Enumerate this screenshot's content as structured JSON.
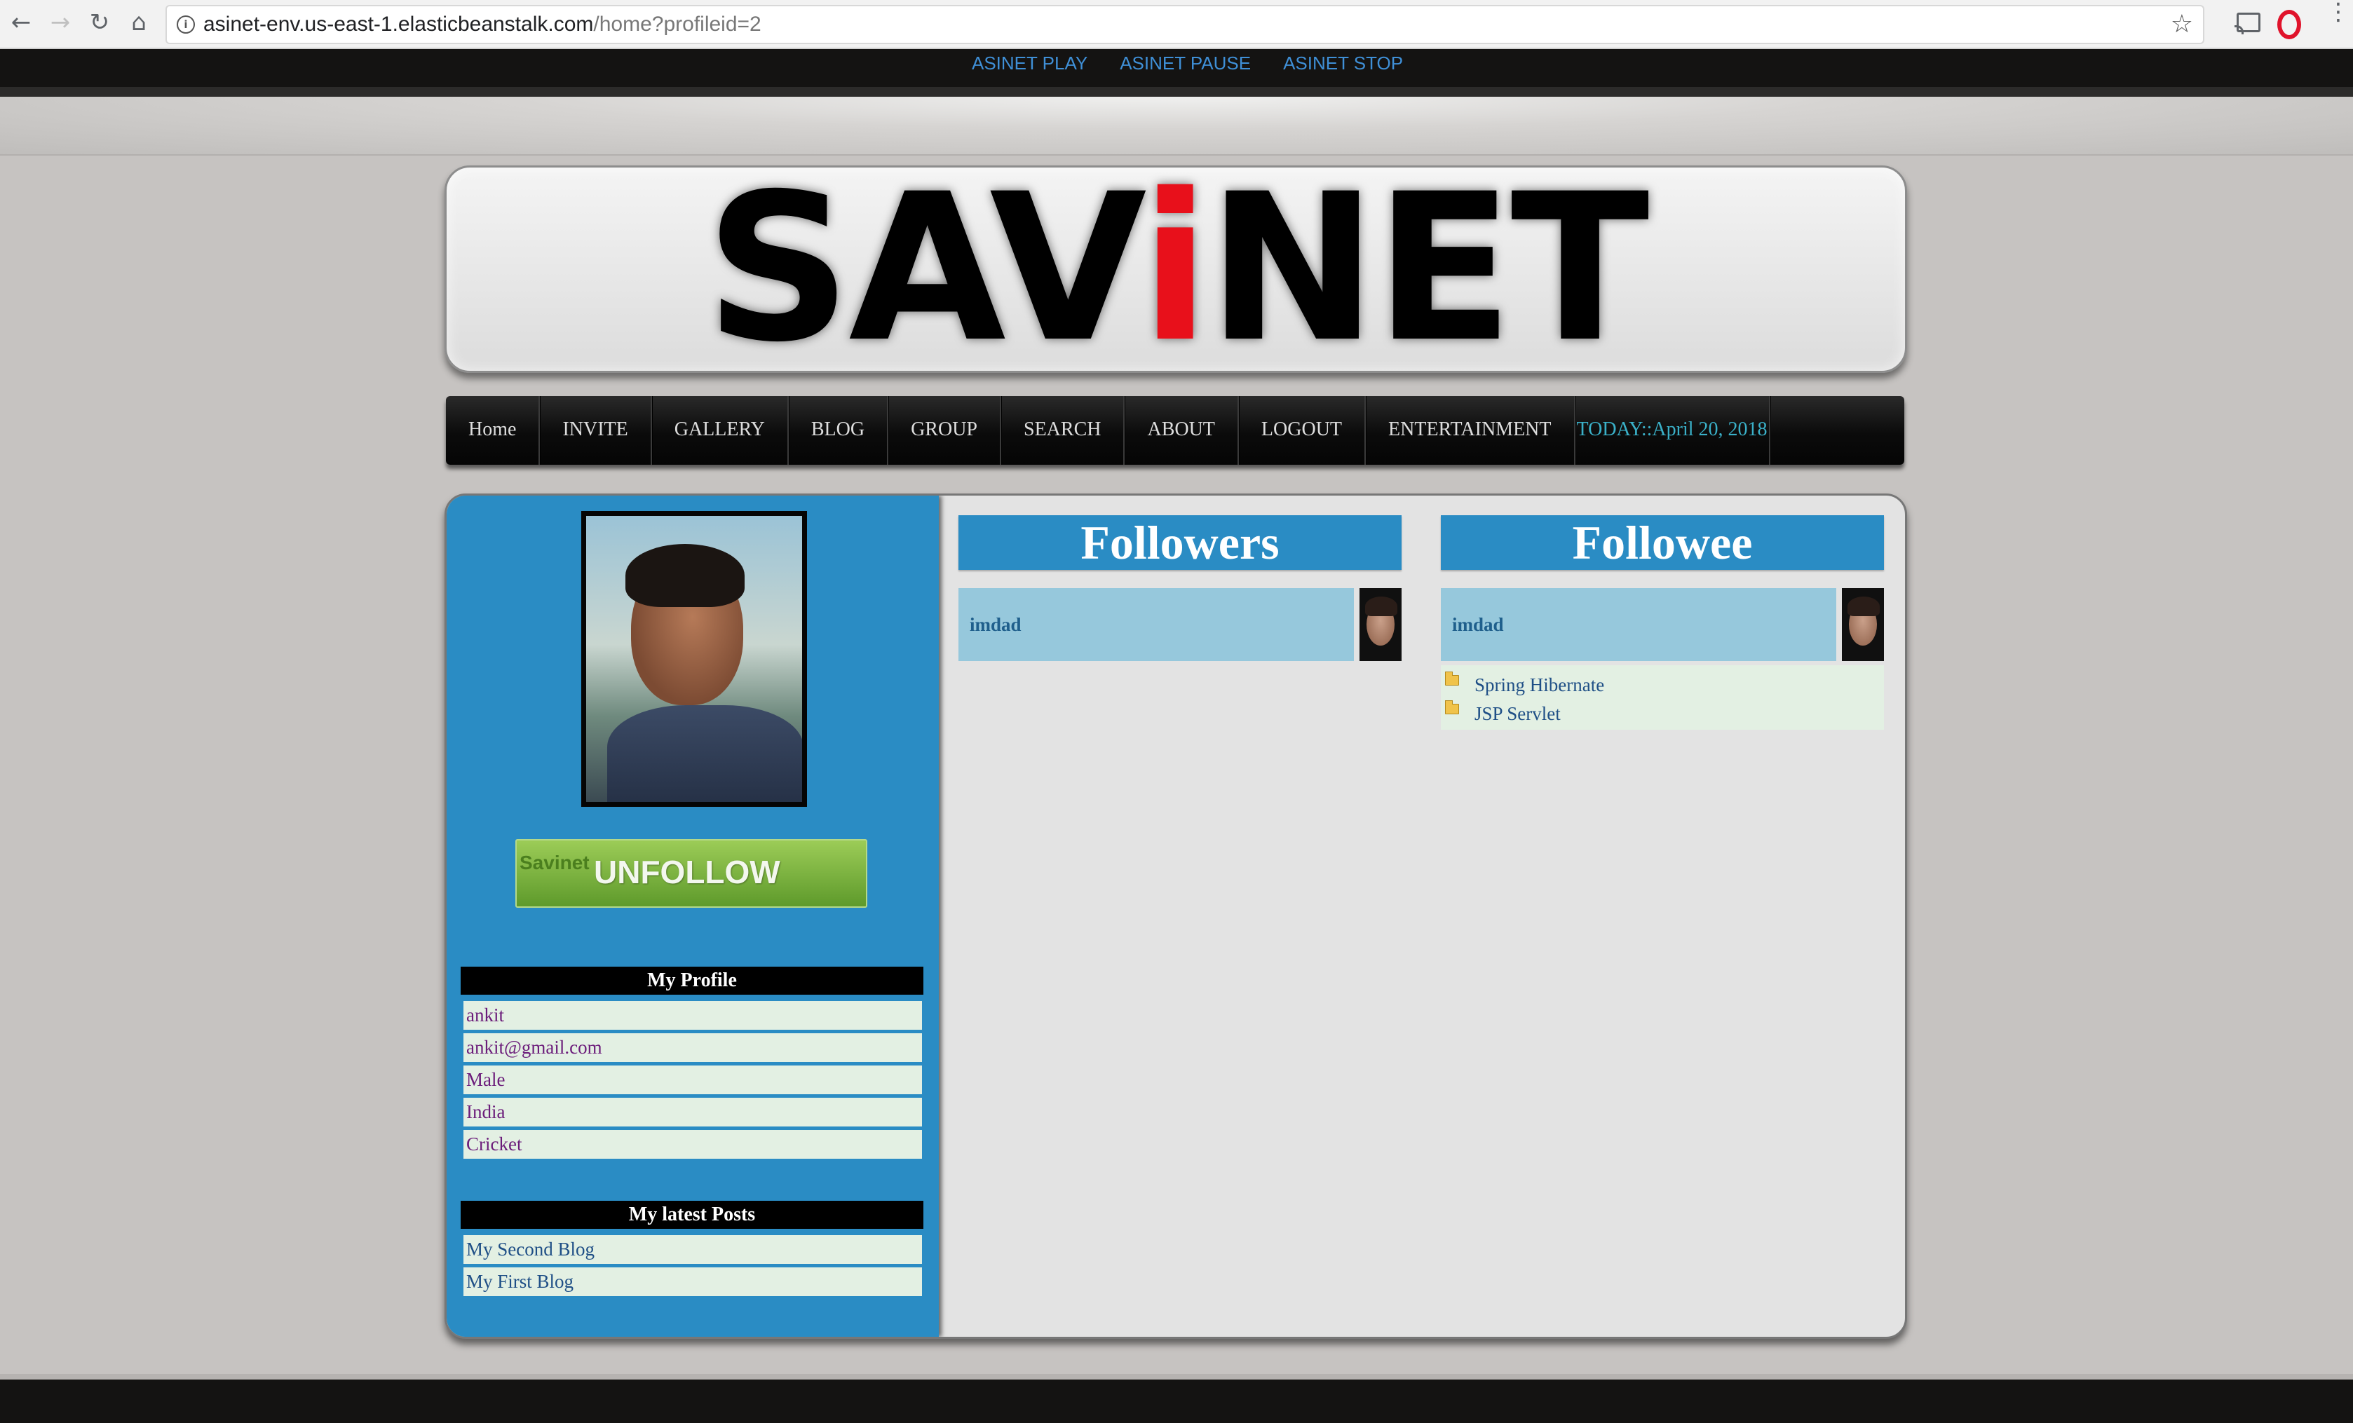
{
  "browser": {
    "url_host": "asinet-env.us-east-1.elasticbeanstalk.com",
    "url_path": "/home?profileid=2",
    "back_icon": "back-arrow-icon",
    "forward_icon": "forward-arrow-icon",
    "reload_icon": "reload-icon",
    "home_icon": "home-icon",
    "info_icon": "info-icon",
    "star_icon": "bookmark-star-icon",
    "star_glyph": "☆",
    "back_glyph": "←",
    "forward_glyph": "→",
    "reload_glyph": "↻",
    "home_glyph": "⌂",
    "info_glyph": "i"
  },
  "media_bar": {
    "links": [
      "ASINET PLAY",
      "ASINET PAUSE",
      "ASINET STOP"
    ]
  },
  "logo": {
    "before": "SAV",
    "accent": "i",
    "after": "NET",
    "accent_color": "#e8101b"
  },
  "nav": {
    "items": [
      "Home",
      "INVITE",
      "GALLERY",
      "BLOG",
      "GROUP",
      "SEARCH",
      "ABOUT",
      "LOGOUT",
      "ENTERTAINMENT"
    ],
    "today": "TODAY::April 20, 2018"
  },
  "sidebar": {
    "unfollow_small": "Savinet",
    "unfollow_label": "UNFOLLOW",
    "profile_heading": "My Profile",
    "profile": [
      "ankit",
      "ankit@gmail.com",
      "Male",
      "India",
      "Cricket"
    ],
    "posts_heading": "My latest Posts",
    "posts": [
      "My Second Blog",
      "My First Blog"
    ]
  },
  "followers": {
    "title": "Followers",
    "people": [
      "imdad"
    ]
  },
  "followee": {
    "title": "Followee",
    "people": [
      "imdad"
    ],
    "topics": [
      "Spring Hibernate",
      "JSP Servlet"
    ]
  },
  "colors": {
    "sidebar_blue": "#2a8cc4",
    "nav_today": "#3ab0c8",
    "unfollow_green": "#6fae34"
  }
}
